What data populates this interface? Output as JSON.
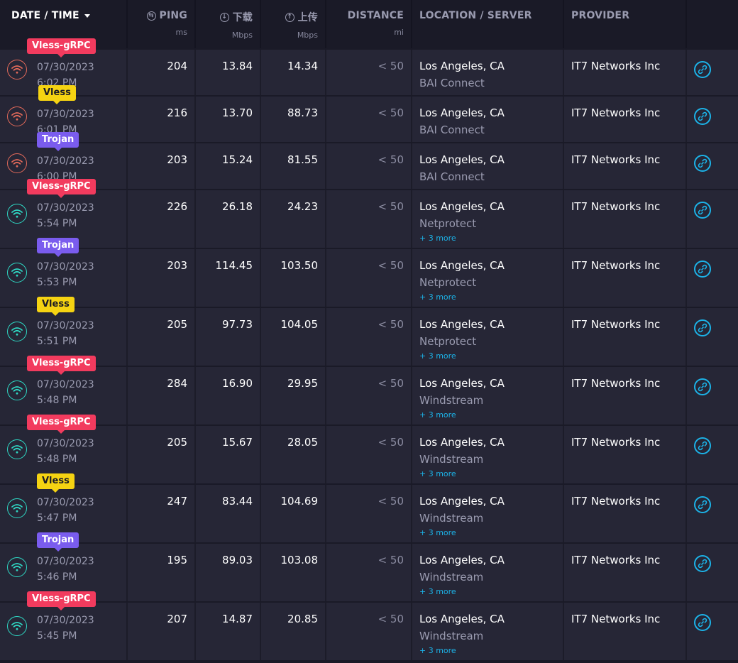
{
  "header": {
    "date_time": "DATE / TIME",
    "ping": "PING",
    "ping_unit": "ms",
    "download": "下载",
    "download_unit": "Mbps",
    "upload": "上传",
    "upload_unit": "Mbps",
    "distance": "DISTANCE",
    "distance_unit": "mi",
    "location": "LOCATION / SERVER",
    "provider": "PROVIDER"
  },
  "colors": {
    "badge_vless_grpc": "#f23b5e",
    "badge_vless": "#f5d312",
    "badge_trojan": "#7a5cee",
    "link": "#1cb3e8",
    "wifi_orange": "#e36a5a",
    "wifi_cyan": "#2fd8c4"
  },
  "rows": [
    {
      "badge": "Vless-gRPC",
      "badge_type": "red",
      "wifi": "orange",
      "date": "07/30/2023",
      "time": "6:02 PM",
      "ping": "204",
      "down": "13.84",
      "up": "14.34",
      "dist": "< 50",
      "city": "Los Angeles, CA",
      "server": "BAI Connect",
      "more": "",
      "provider": "IT7 Networks Inc"
    },
    {
      "badge": "Vless",
      "badge_type": "yellow",
      "wifi": "orange",
      "date": "07/30/2023",
      "time": "6:01 PM",
      "ping": "216",
      "down": "13.70",
      "up": "88.73",
      "dist": "< 50",
      "city": "Los Angeles, CA",
      "server": "BAI Connect",
      "more": "",
      "provider": "IT7 Networks Inc"
    },
    {
      "badge": "Trojan",
      "badge_type": "purple",
      "wifi": "orange",
      "date": "07/30/2023",
      "time": "6:00 PM",
      "ping": "203",
      "down": "15.24",
      "up": "81.55",
      "dist": "< 50",
      "city": "Los Angeles, CA",
      "server": "BAI Connect",
      "more": "",
      "provider": "IT7 Networks Inc"
    },
    {
      "badge": "Vless-gRPC",
      "badge_type": "red",
      "wifi": "cyan",
      "date": "07/30/2023",
      "time": "5:54 PM",
      "ping": "226",
      "down": "26.18",
      "up": "24.23",
      "dist": "< 50",
      "city": "Los Angeles, CA",
      "server": "Netprotect",
      "more": "+ 3 more",
      "provider": "IT7 Networks Inc"
    },
    {
      "badge": "Trojan",
      "badge_type": "purple",
      "wifi": "cyan",
      "date": "07/30/2023",
      "time": "5:53 PM",
      "ping": "203",
      "down": "114.45",
      "up": "103.50",
      "dist": "< 50",
      "city": "Los Angeles, CA",
      "server": "Netprotect",
      "more": "+ 3 more",
      "provider": "IT7 Networks Inc"
    },
    {
      "badge": "Vless",
      "badge_type": "yellow",
      "wifi": "cyan",
      "date": "07/30/2023",
      "time": "5:51 PM",
      "ping": "205",
      "down": "97.73",
      "up": "104.05",
      "dist": "< 50",
      "city": "Los Angeles, CA",
      "server": "Netprotect",
      "more": "+ 3 more",
      "provider": "IT7 Networks Inc"
    },
    {
      "badge": "Vless-gRPC",
      "badge_type": "red",
      "wifi": "cyan",
      "date": "07/30/2023",
      "time": "5:48 PM",
      "ping": "284",
      "down": "16.90",
      "up": "29.95",
      "dist": "< 50",
      "city": "Los Angeles, CA",
      "server": "Windstream",
      "more": "+ 3 more",
      "provider": "IT7 Networks Inc"
    },
    {
      "badge": "Vless-gRPC",
      "badge_type": "red",
      "wifi": "cyan",
      "date": "07/30/2023",
      "time": "5:48 PM",
      "ping": "205",
      "down": "15.67",
      "up": "28.05",
      "dist": "< 50",
      "city": "Los Angeles, CA",
      "server": "Windstream",
      "more": "+ 3 more",
      "provider": "IT7 Networks Inc"
    },
    {
      "badge": "Vless",
      "badge_type": "yellow",
      "wifi": "cyan",
      "date": "07/30/2023",
      "time": "5:47 PM",
      "ping": "247",
      "down": "83.44",
      "up": "104.69",
      "dist": "< 50",
      "city": "Los Angeles, CA",
      "server": "Windstream",
      "more": "+ 3 more",
      "provider": "IT7 Networks Inc"
    },
    {
      "badge": "Trojan",
      "badge_type": "purple",
      "wifi": "cyan",
      "date": "07/30/2023",
      "time": "5:46 PM",
      "ping": "195",
      "down": "89.03",
      "up": "103.08",
      "dist": "< 50",
      "city": "Los Angeles, CA",
      "server": "Windstream",
      "more": "+ 3 more",
      "provider": "IT7 Networks Inc"
    },
    {
      "badge": "Vless-gRPC",
      "badge_type": "red",
      "wifi": "cyan",
      "date": "07/30/2023",
      "time": "5:45 PM",
      "ping": "207",
      "down": "14.87",
      "up": "20.85",
      "dist": "< 50",
      "city": "Los Angeles, CA",
      "server": "Windstream",
      "more": "+ 3 more",
      "provider": "IT7 Networks Inc"
    }
  ]
}
